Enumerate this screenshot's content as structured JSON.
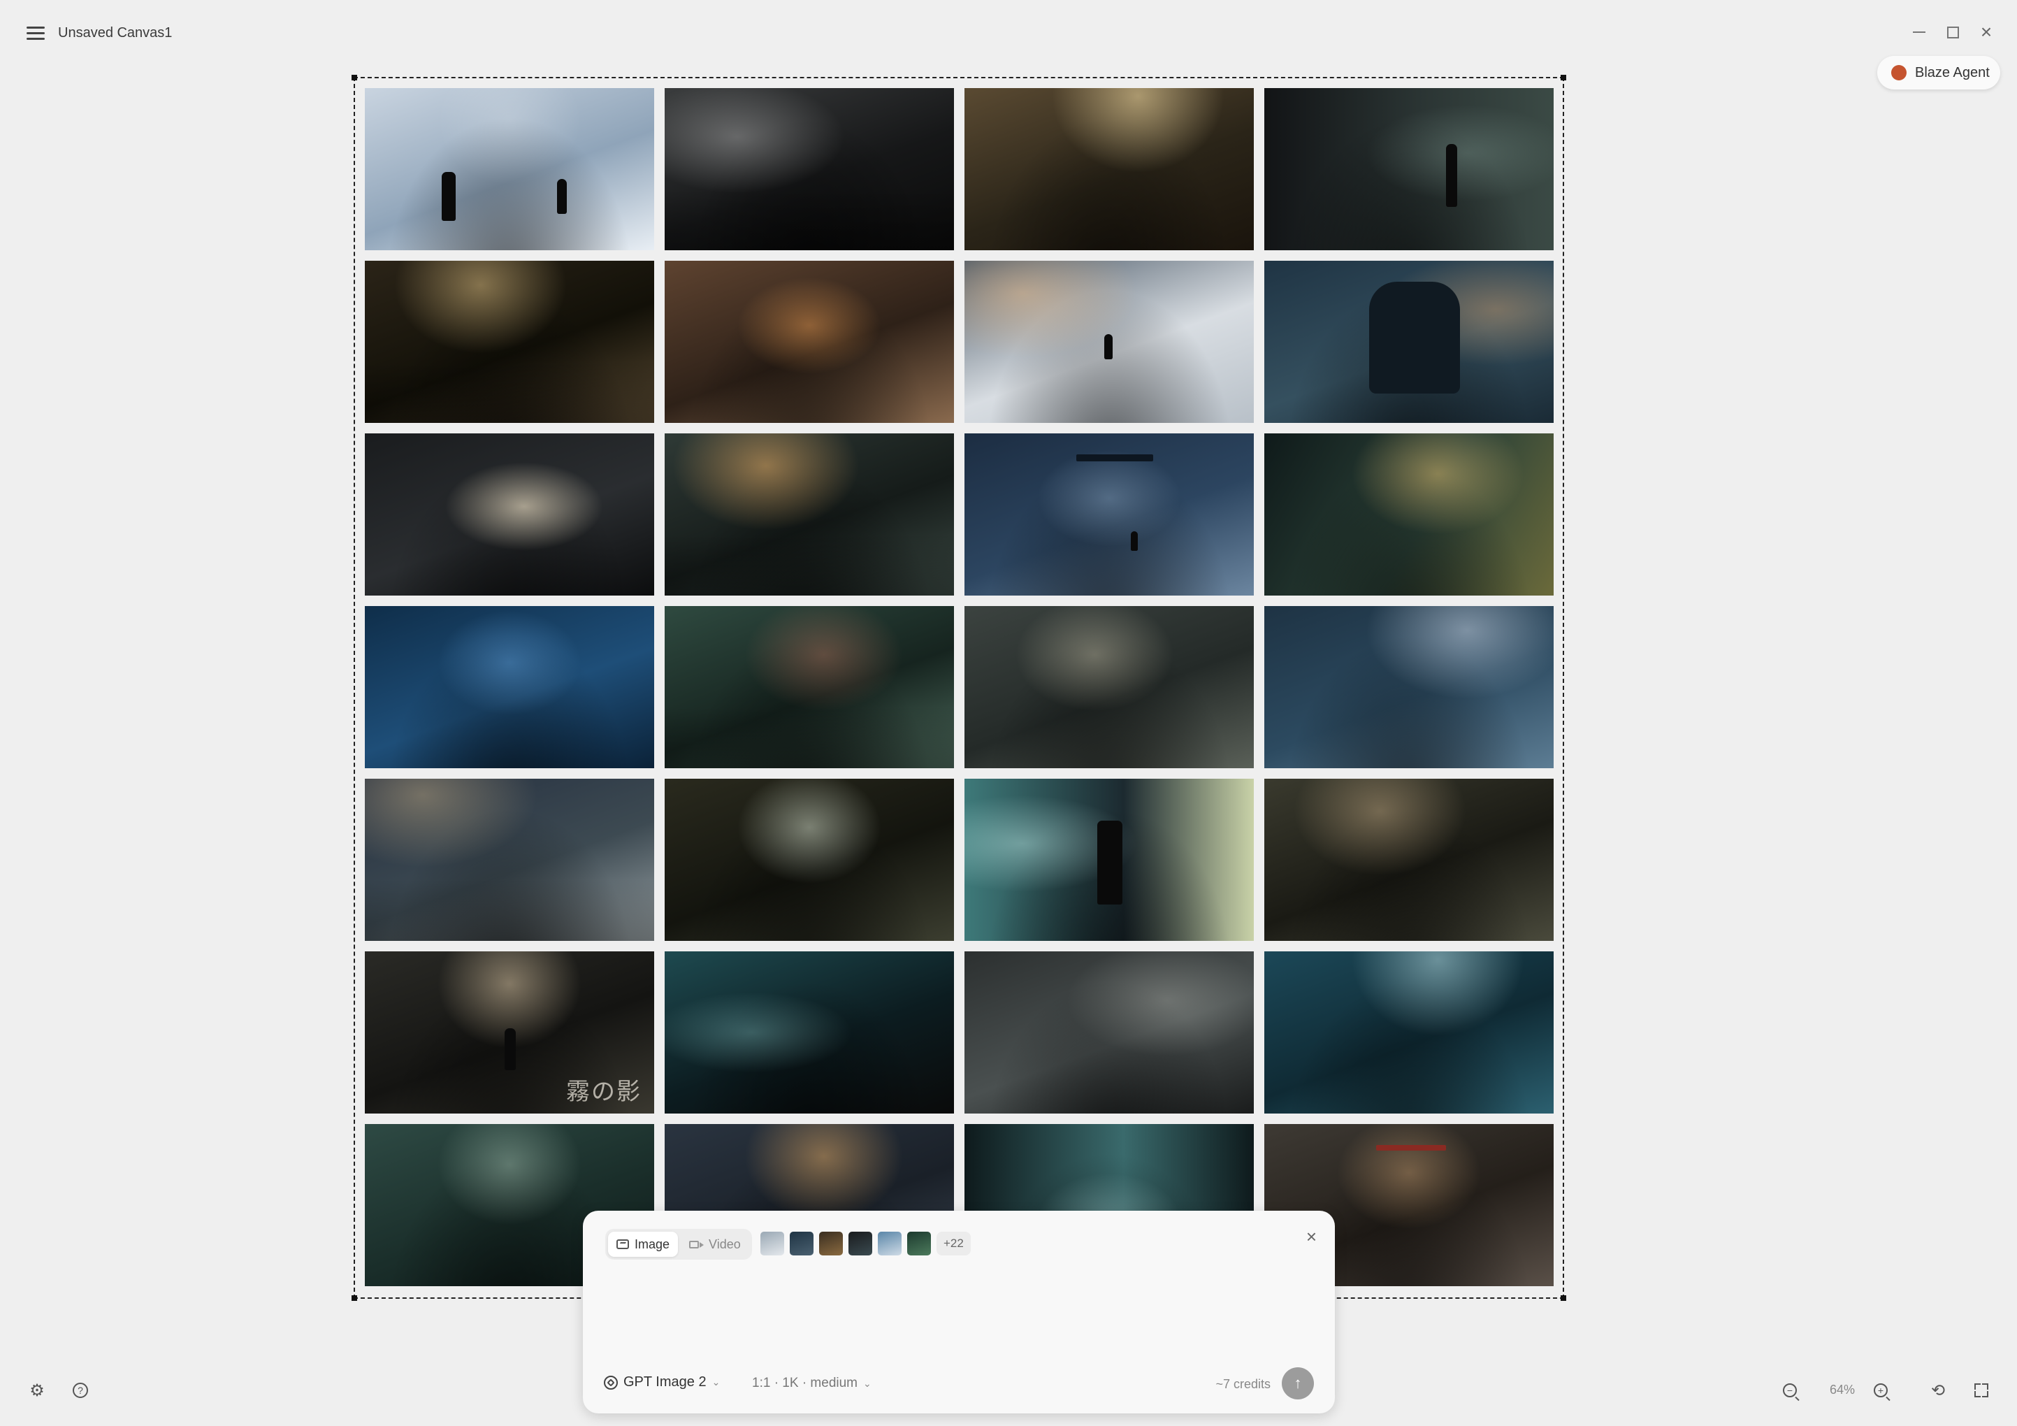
{
  "window": {
    "title": "Unsaved Canvas1",
    "icons": {
      "menu": "hamburger-menu-icon",
      "minimize": "minimize-icon",
      "maximize": "maximize-icon",
      "close": "close-icon"
    }
  },
  "agent": {
    "label": "Blaze Agent",
    "icon": "blaze-agent-logo"
  },
  "canvas": {
    "image_count": 28,
    "images": [
      "snowy-shrine-samurai",
      "dark-empty-room",
      "hand-opening-door",
      "samurai-in-doorway",
      "dark-corridor",
      "crowd-festival",
      "snowy-courtyard-samurai",
      "armored-samurai-street",
      "flashlight-hallway",
      "rainy-alley-bicycles",
      "rain-torii-gate",
      "window-rainy-street",
      "blue-forest-torii",
      "green-hallway-umbrella",
      "school-corridor",
      "empty-classroom-blue",
      "rainy-road-puddle",
      "narrow-hallway",
      "convenience-store",
      "woman-peeking-wall",
      "umbrella-alley",
      "bathroom-stall",
      "camera-rainy-street",
      "locker-room-floor",
      "foggy-classroom",
      "night-street-lamp",
      "train-platform",
      "red-torii-lanterns"
    ],
    "caption": "霧の影"
  },
  "prompt_panel": {
    "tabs": [
      {
        "label": "Image",
        "active": true
      },
      {
        "label": "Video",
        "active": false
      }
    ],
    "attached_thumbnails": 6,
    "more_count": "+22",
    "input_value": "",
    "model": "GPT Image 2",
    "settings": "1:1 · 1K · medium",
    "credits": "~7 credits",
    "send_icon": "arrow-up-icon"
  },
  "bottom_bar": {
    "zoom": "64%",
    "icons": [
      "settings-gear-icon",
      "help-circle-icon",
      "zoom-out-icon",
      "zoom-in-icon",
      "fit-view-icon",
      "fullscreen-icon"
    ]
  },
  "colors": {
    "background": "#efefef",
    "agent_accent": "#c5542f",
    "send_button": "#9c9c9c"
  }
}
